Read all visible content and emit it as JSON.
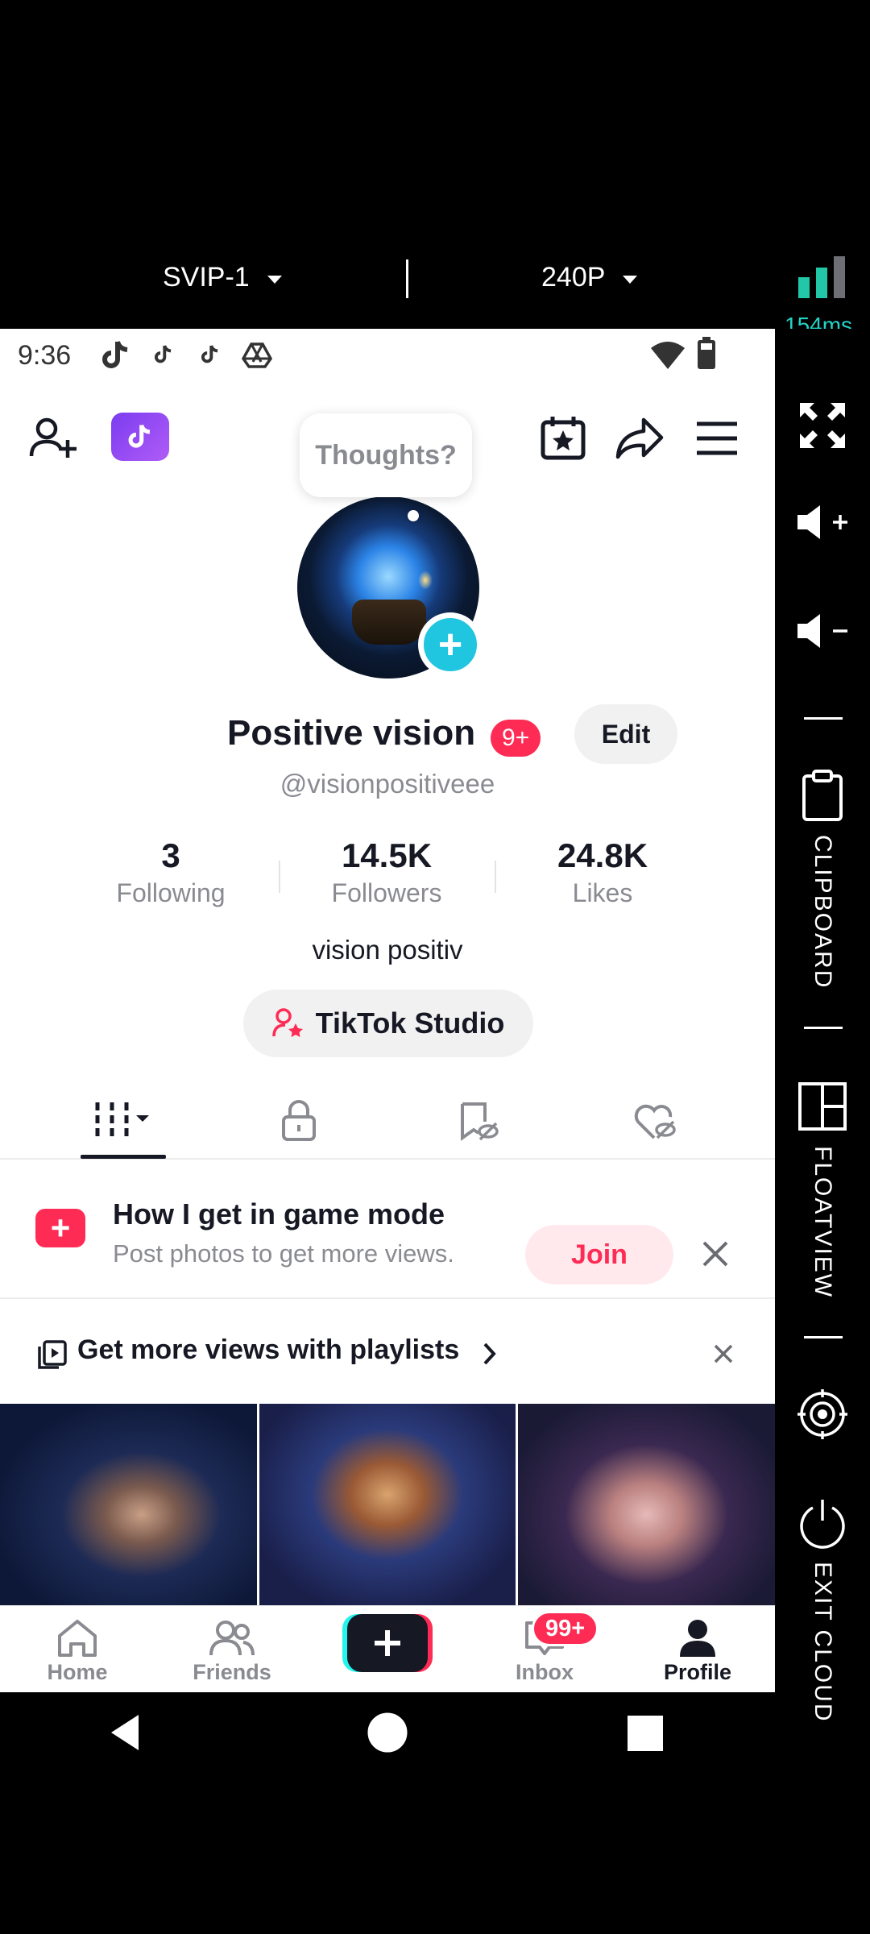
{
  "cloud": {
    "quality_tier": "SVIP-1",
    "resolution": "240P",
    "latency": "154ms",
    "side_panel": {
      "clipboard": "CLIPBOARD",
      "floatview": "FLOATVIEW",
      "exit": "EXIT CLOUD"
    }
  },
  "status_bar": {
    "time": "9:36"
  },
  "profile": {
    "thought_bubble": "Thoughts?",
    "name": "Positive vision",
    "name_badge": "9+",
    "edit_label": "Edit",
    "handle": "@visionpositiveee",
    "stats": [
      {
        "value": "3",
        "label": "Following"
      },
      {
        "value": "14.5K",
        "label": "Followers"
      },
      {
        "value": "24.8K",
        "label": "Likes"
      }
    ],
    "bio": "vision positiv",
    "studio_label": "TikTok Studio"
  },
  "promo": {
    "title": "How I get in game mode",
    "subtitle": "Post photos to get more views.",
    "join_label": "Join"
  },
  "playlist_banner": {
    "text": "Get more views with playlists"
  },
  "bottom_nav": {
    "home": "Home",
    "friends": "Friends",
    "inbox": "Inbox",
    "inbox_badge": "99+",
    "profile": "Profile"
  },
  "colors": {
    "accent": "#fe2c55",
    "cyan": "#20c5e0",
    "latency": "#22d3c5",
    "muted": "#8a8b91"
  }
}
